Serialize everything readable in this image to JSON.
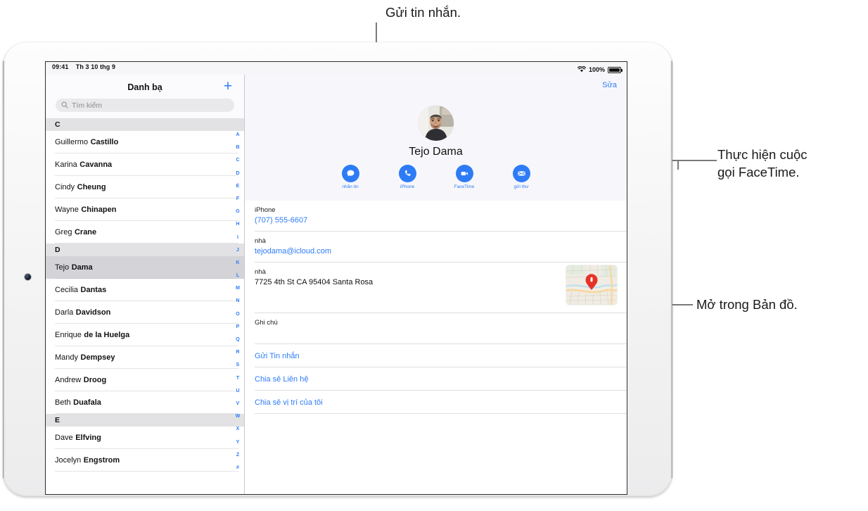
{
  "status_bar": {
    "time": "09:41",
    "date": "Th 3 10 thg 9",
    "battery_percent": "100%",
    "wifi_icon": "wifi-icon",
    "battery_icon": "battery-icon"
  },
  "sidebar": {
    "title": "Danh bạ",
    "add_label": "+",
    "search": {
      "placeholder": "Tìm kiếm",
      "value": "",
      "icon": "search-icon"
    },
    "sections": [
      {
        "letter": "C",
        "contacts": [
          {
            "first": "Guillermo",
            "last": "Castillo",
            "selected": false
          },
          {
            "first": "Karina",
            "last": "Cavanna",
            "selected": false
          },
          {
            "first": "Cindy",
            "last": "Cheung",
            "selected": false
          },
          {
            "first": "Wayne",
            "last": "Chinapen",
            "selected": false
          },
          {
            "first": "Greg",
            "last": "Crane",
            "selected": false
          }
        ]
      },
      {
        "letter": "D",
        "contacts": [
          {
            "first": "Tejo",
            "last": "Dama",
            "selected": true
          },
          {
            "first": "Cecilia",
            "last": "Dantas",
            "selected": false
          },
          {
            "first": "Darla",
            "last": "Davidson",
            "selected": false
          },
          {
            "first": "Enrique",
            "last": "de la Huelga",
            "selected": false
          },
          {
            "first": "Mandy",
            "last": "Dempsey",
            "selected": false
          },
          {
            "first": "Andrew",
            "last": "Droog",
            "selected": false
          },
          {
            "first": "Beth",
            "last": "Duafala",
            "selected": false
          }
        ]
      },
      {
        "letter": "E",
        "contacts": [
          {
            "first": "Dave",
            "last": "Elfving",
            "selected": false
          },
          {
            "first": "Jocelyn",
            "last": "Engstrom",
            "selected": false
          }
        ]
      }
    ],
    "index_letters": [
      "A",
      "B",
      "C",
      "D",
      "E",
      "F",
      "G",
      "H",
      "I",
      "J",
      "K",
      "L",
      "M",
      "N",
      "O",
      "P",
      "Q",
      "R",
      "S",
      "T",
      "U",
      "V",
      "W",
      "X",
      "Y",
      "Z",
      "#"
    ]
  },
  "detail": {
    "edit_label": "Sửa",
    "avatar_name": "contact-avatar",
    "contact_name": "Tejo Dama",
    "actions": [
      {
        "label": "nhắn tin",
        "icon": "message-icon"
      },
      {
        "label": "iPhone",
        "icon": "phone-icon"
      },
      {
        "label": "FaceTime",
        "icon": "video-camera-icon"
      },
      {
        "label": "gửi thư",
        "icon": "mail-icon"
      }
    ],
    "fields": [
      {
        "label": "iPhone",
        "value": "(707) 555-6607",
        "is_link": true
      },
      {
        "label": "nhà",
        "value": "tejodama@icloud.com",
        "is_link": true
      },
      {
        "label": "nhà",
        "value": "7725 4th St CA 95404 Santa Rosa",
        "is_link": false,
        "has_map": true
      },
      {
        "label": "Ghi chú",
        "value": "",
        "is_link": false
      }
    ],
    "link_rows": [
      "Gửi Tin nhắn",
      "Chia sẻ Liên hệ",
      "Chia sẻ vị trí của tôi"
    ],
    "map_thumbnail_icon": "map-pin-icon"
  },
  "callouts": {
    "top": "Gửi tin nhắn.",
    "right_line1": "Thực hiện cuộc",
    "right_line2": "gọi FaceTime.",
    "bottom_right": "Mở trong Bản đồ."
  },
  "colors": {
    "accent_blue": "#2d7cf6",
    "selected_row": "#d3d3d8",
    "section_header": "#e2e2e5",
    "callout_line": "#7a7a7a"
  }
}
